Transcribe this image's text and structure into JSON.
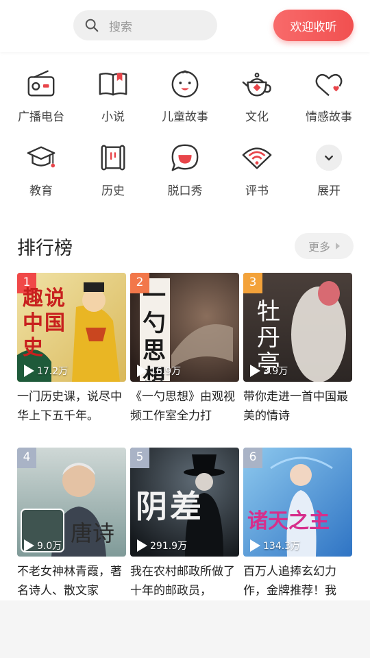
{
  "header": {
    "search_placeholder": "搜索",
    "welcome_button": "欢迎收听"
  },
  "categories": [
    {
      "label": "广播电台",
      "icon": "radio-icon"
    },
    {
      "label": "小说",
      "icon": "book-icon"
    },
    {
      "label": "儿童故事",
      "icon": "child-face-icon"
    },
    {
      "label": "文化",
      "icon": "teapot-icon"
    },
    {
      "label": "情感故事",
      "icon": "heart-cloud-icon"
    },
    {
      "label": "教育",
      "icon": "graduation-cap-icon"
    },
    {
      "label": "历史",
      "icon": "scroll-icon"
    },
    {
      "label": "脱口秀",
      "icon": "speech-bubble-icon"
    },
    {
      "label": "评书",
      "icon": "fan-icon"
    },
    {
      "label": "展开",
      "icon": "chevron-down-icon"
    }
  ],
  "ranking": {
    "title": "排行榜",
    "more_label": "更多",
    "items": [
      {
        "rank": "1",
        "plays": "17.2万",
        "desc": "一门历史课，说尽中华上下五千年。",
        "cover_text": "趣说中国史",
        "badge_color": "#f04848"
      },
      {
        "rank": "2",
        "plays": "16.9万",
        "desc": "《一勺思想》由观视频工作室全力打",
        "cover_text": "一勺思想",
        "badge_color": "#f2774a"
      },
      {
        "rank": "3",
        "plays": "3.9万",
        "desc": "带你走进一首中国最美的情诗",
        "cover_text": "牡丹亭",
        "badge_color": "#f3a23a"
      },
      {
        "rank": "4",
        "plays": "9.0万",
        "desc": "不老女神林青霞，著名诗人、散文家",
        "cover_text": "唐诗",
        "badge_color": "#a9b3c6"
      },
      {
        "rank": "5",
        "plays": "291.9万",
        "desc": "我在农村邮政所做了十年的邮政员，",
        "cover_text": "阴差",
        "badge_color": "#a9b3c6"
      },
      {
        "rank": "6",
        "plays": "134.3万",
        "desc": "百万人追捧玄幻力作，金牌推荐！我",
        "cover_text": "诸天之主",
        "badge_color": "#a9b3c6"
      }
    ]
  },
  "colors": {
    "accent": "#f15050",
    "icon_red": "#e8454a"
  }
}
